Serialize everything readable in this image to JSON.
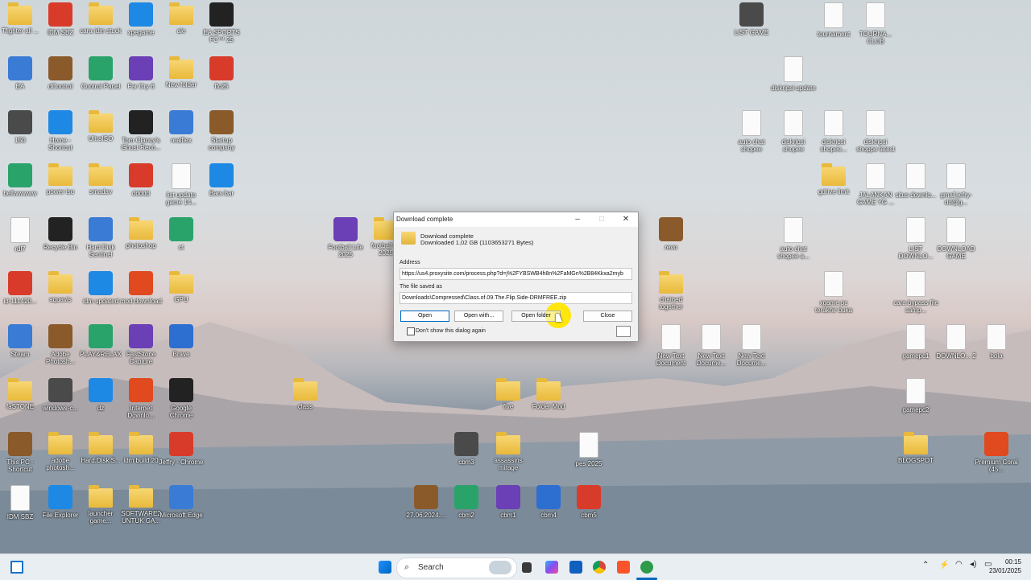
{
  "desktop_icons": [
    {
      "label": "Tfighter all ...",
      "type": "folder"
    },
    {
      "label": "IDM SBZ",
      "type": "app"
    },
    {
      "label": "cara idm stuck",
      "type": "folder"
    },
    {
      "label": "xpegame",
      "type": "app"
    },
    {
      "label": "ale",
      "type": "folder"
    },
    {
      "label": "EA SPORTS FC™ 25",
      "type": "app"
    },
    {
      "label": "EA",
      "type": "app"
    },
    {
      "label": "dControl",
      "type": "app"
    },
    {
      "label": "Control Panel",
      "type": "app"
    },
    {
      "label": "Far Cry 6",
      "type": "app"
    },
    {
      "label": "New folder",
      "type": "folder"
    },
    {
      "label": "ffc25",
      "type": "app"
    },
    {
      "label": "150",
      "type": "app"
    },
    {
      "label": "Home - Shortcut",
      "type": "app"
    },
    {
      "label": "UltraISO",
      "type": "folder"
    },
    {
      "label": "Tom Clancy's Ghost Reco...",
      "type": "app"
    },
    {
      "label": "realflex",
      "type": "app"
    },
    {
      "label": "Startup company",
      "type": "app"
    },
    {
      "label": "bellwwwww",
      "type": "app"
    },
    {
      "label": "power iso",
      "type": "folder"
    },
    {
      "label": "smadav",
      "type": "folder"
    },
    {
      "label": "ddddd",
      "type": "app"
    },
    {
      "label": "list update game 14...",
      "type": "doc"
    },
    {
      "label": "Bars bar",
      "type": "app"
    },
    {
      "label": "rdl7",
      "type": "doc"
    },
    {
      "label": "Recycle Bin",
      "type": "app"
    },
    {
      "label": "Hard Disk Sentinel",
      "type": "app"
    },
    {
      "label": "photoshop",
      "type": "folder"
    },
    {
      "label": "ct",
      "type": "app"
    },
    {
      "label": "Football Life 2025",
      "type": "app"
    },
    {
      "label": "football l... 2025",
      "type": "folder"
    },
    {
      "label": "id-111420...",
      "type": "app"
    },
    {
      "label": "aquavis",
      "type": "folder"
    },
    {
      "label": "idm updated",
      "type": "app"
    },
    {
      "label": "mod download",
      "type": "app"
    },
    {
      "label": "GPU",
      "type": "folder"
    },
    {
      "label": "Steam",
      "type": "app"
    },
    {
      "label": "Adobe Photosh...",
      "type": "app"
    },
    {
      "label": "PLAY&RELAX",
      "type": "app"
    },
    {
      "label": "FastStone Capture",
      "type": "app"
    },
    {
      "label": "Brave",
      "type": "app"
    },
    {
      "label": "faSTONE",
      "type": "folder"
    },
    {
      "label": "windows-c...",
      "type": "app"
    },
    {
      "label": "dz",
      "type": "app"
    },
    {
      "label": "Internet Downlo...",
      "type": "app"
    },
    {
      "label": "Google Chrome",
      "type": "app"
    },
    {
      "label": "class",
      "type": "folder"
    },
    {
      "label": "This PC - Shortcut",
      "type": "app"
    },
    {
      "label": "adobe photosh...",
      "type": "folder"
    },
    {
      "label": "Hard.Disk.S...",
      "type": "folder"
    },
    {
      "label": "idm build 20",
      "type": "folder"
    },
    {
      "label": "Jeffry - Chrome",
      "type": "app"
    },
    {
      "label": "IDM SBZ",
      "type": "doc"
    },
    {
      "label": "File Explorer",
      "type": "app"
    },
    {
      "label": "launcher game...",
      "type": "folder"
    },
    {
      "label": "SOFTWARE2 UNTUK GA...",
      "type": "folder"
    },
    {
      "label": "Microsoft Edge",
      "type": "app"
    },
    {
      "label": "27.06.2024....",
      "type": "app"
    },
    {
      "label": "cbm2",
      "type": "app"
    },
    {
      "label": "cbm1",
      "type": "app"
    },
    {
      "label": "cbm4",
      "type": "app"
    },
    {
      "label": "cbm5",
      "type": "app"
    },
    {
      "label": "cbm3",
      "type": "app"
    },
    {
      "label": "assassins mirage",
      "type": "folder"
    },
    {
      "label": "pes 2025",
      "type": "doc"
    },
    {
      "label": "five",
      "type": "folder"
    },
    {
      "label": "Folder Mod",
      "type": "folder"
    },
    {
      "label": "revo",
      "type": "app"
    },
    {
      "label": "chained together",
      "type": "folder"
    },
    {
      "label": "New Text Document",
      "type": "doc"
    },
    {
      "label": "New Text Docume...",
      "type": "doc"
    },
    {
      "label": "New Text Docume...",
      "type": "doc"
    },
    {
      "label": "LIST GAME",
      "type": "app"
    },
    {
      "label": "tournament",
      "type": "doc"
    },
    {
      "label": "TOURNA... CLUB",
      "type": "doc"
    },
    {
      "label": "diskripsi update",
      "type": "doc"
    },
    {
      "label": "auto chat shopee",
      "type": "doc"
    },
    {
      "label": "diskripsi shopee",
      "type": "doc"
    },
    {
      "label": "diskripsi shopee...",
      "type": "doc"
    },
    {
      "label": "diskripsi shoppe latest",
      "type": "doc"
    },
    {
      "label": "gdrive limit",
      "type": "folder"
    },
    {
      "label": "JALANKAN GAME YG ...",
      "type": "doc"
    },
    {
      "label": "situs downlo...",
      "type": "doc"
    },
    {
      "label": "gmail jefry-dd@g...",
      "type": "doc"
    },
    {
      "label": "auto chat shopee a...",
      "type": "doc"
    },
    {
      "label": "LIST DOWNLO...",
      "type": "doc"
    },
    {
      "label": "DOWNLOAD GAME",
      "type": "doc"
    },
    {
      "label": "xgame pc terakhir buka",
      "type": "doc"
    },
    {
      "label": "cara bypass file samp...",
      "type": "doc"
    },
    {
      "label": "gamepc1",
      "type": "doc"
    },
    {
      "label": "DOWNLO... 2",
      "type": "doc"
    },
    {
      "label": "bola",
      "type": "doc"
    },
    {
      "label": "gamepc2",
      "type": "doc"
    },
    {
      "label": "BLOGSPOT",
      "type": "folder"
    },
    {
      "label": "Premium Coral (45...",
      "type": "app"
    }
  ],
  "dialog": {
    "title": "Download complete",
    "heading": "Download complete",
    "size_text": "Downloaded 1,02 GB (1103653271 Bytes)",
    "address_label": "Address",
    "address_value": "https://us4.proxysite.com/process.php?d=j%2FYBSWB4h8n%2FaMGn%2B84Kkxa2myb",
    "saved_label": "The file saved as",
    "saved_value": "Downloads\\Compressed\\Class.of.09.The.Flip.Side-DRMFREE.zip",
    "btn_open": "Open",
    "btn_open_with": "Open with...",
    "btn_open_folder": "Open folder",
    "btn_close": "Close",
    "checkbox_label": "Don't show this dialog again",
    "checkbox_checked": false
  },
  "taskbar": {
    "search_placeholder": "Search",
    "time": "00:15",
    "date": "23/01/2025"
  },
  "colors": {
    "accent": "#0067c0",
    "folder": "#f0c44c",
    "highlight": "#ffe500"
  }
}
